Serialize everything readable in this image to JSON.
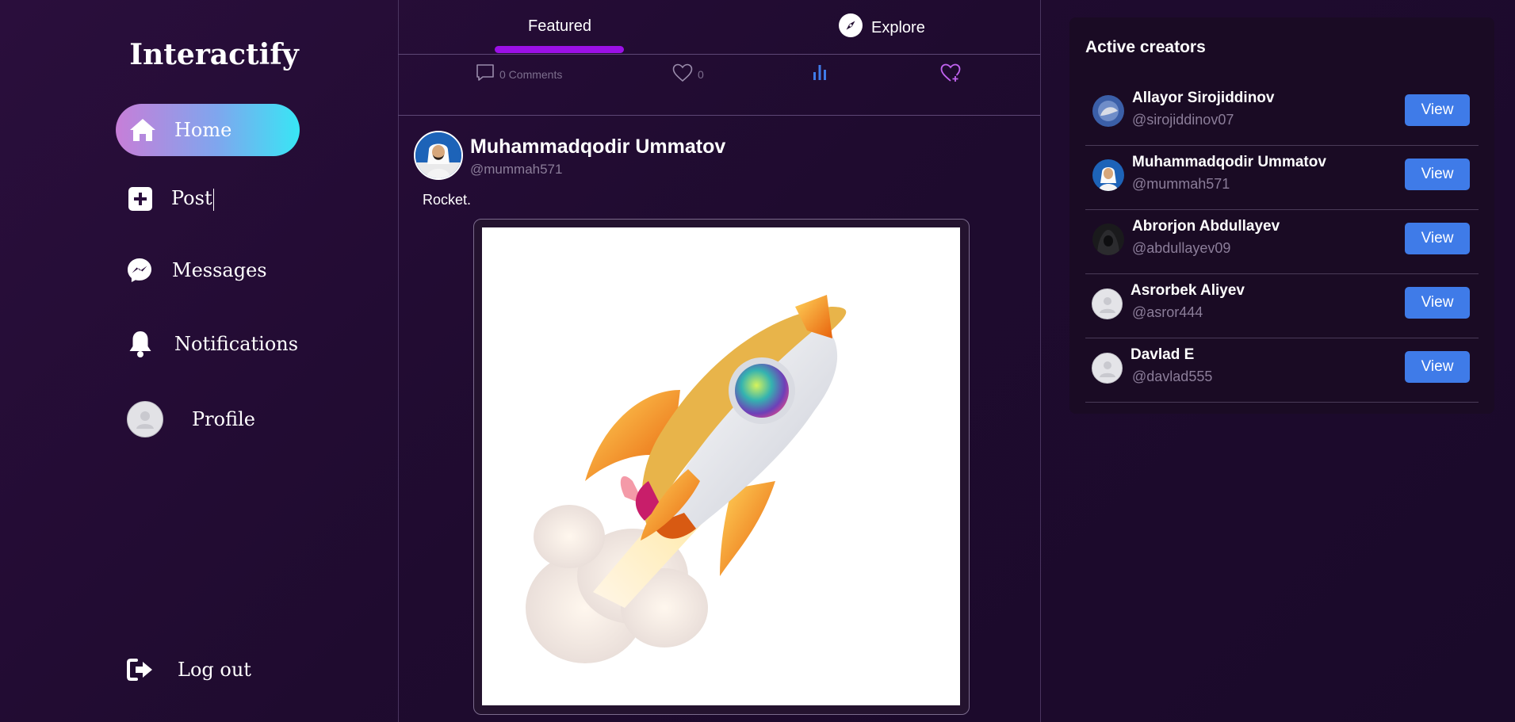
{
  "app": {
    "name": "Interactify"
  },
  "sidebar": {
    "items": [
      {
        "label": "Home",
        "icon": "home-icon"
      },
      {
        "label": "Post",
        "icon": "plus-square-icon"
      },
      {
        "label": "Messages",
        "icon": "messenger-icon"
      },
      {
        "label": "Notifications",
        "icon": "bell-icon"
      },
      {
        "label": "Profile",
        "icon": "avatar"
      }
    ],
    "logout": {
      "label": "Log out",
      "icon": "logout-icon"
    }
  },
  "feed": {
    "tabs": [
      {
        "label": "Featured",
        "active": true
      },
      {
        "label": "Explore",
        "icon": "compass-icon"
      }
    ],
    "actions": {
      "comments_label": "0 Comments",
      "likes_count": "0"
    },
    "post": {
      "author_name": "Muhammadqodir Ummatov",
      "author_handle": "@mummah571",
      "text": "Rocket.",
      "media": "rocket-image"
    }
  },
  "creators": {
    "title": "Active creators",
    "view_label": "View",
    "items": [
      {
        "name": "Allayor Sirojiddinov",
        "handle": "@sirojiddinov07"
      },
      {
        "name": "Muhammadqodir Ummatov",
        "handle": "@mummah571"
      },
      {
        "name": "Abrorjon Abdullayev",
        "handle": "@abdullayev09"
      },
      {
        "name": "Asrorbek Aliyev",
        "handle": "@asror444"
      },
      {
        "name": "Davlad E",
        "handle": "@davlad555"
      }
    ]
  },
  "colors": {
    "accent_purple": "#9b10e6",
    "button_blue": "#3f7be8",
    "stats_blue": "#3f7be8",
    "save_pink": "#c163f0"
  }
}
